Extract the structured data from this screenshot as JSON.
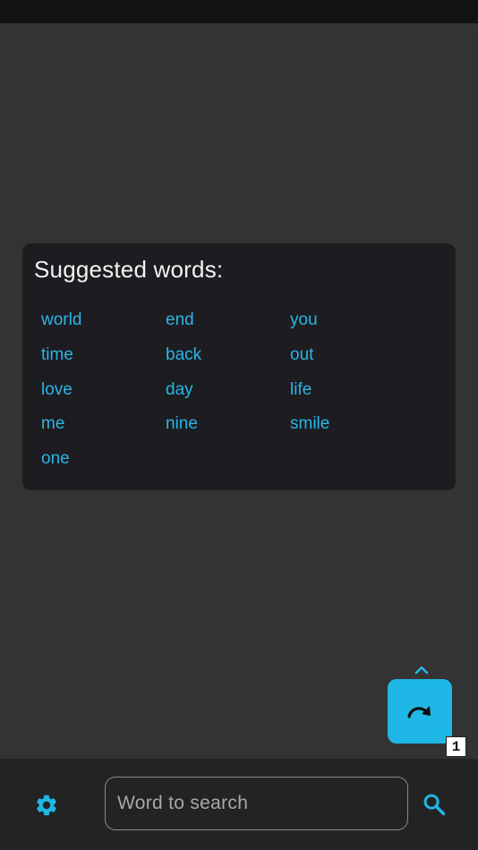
{
  "suggestions": {
    "title": "Suggested words:",
    "words": [
      "world",
      "end",
      "you",
      "time",
      "back",
      "out",
      "love",
      "day",
      "life",
      "me",
      "nine",
      "smile",
      "one"
    ]
  },
  "fab": {
    "icon": "redo-icon",
    "badge": "1",
    "expand_icon": "chevron-up-icon"
  },
  "bottom_bar": {
    "settings_icon": "gear-icon",
    "search_placeholder": "Word to search",
    "search_value": "",
    "search_icon": "search-icon"
  },
  "colors": {
    "accent": "#1fb8e6",
    "link": "#29b6e6",
    "background": "#333333",
    "card": "#1d1c20"
  }
}
